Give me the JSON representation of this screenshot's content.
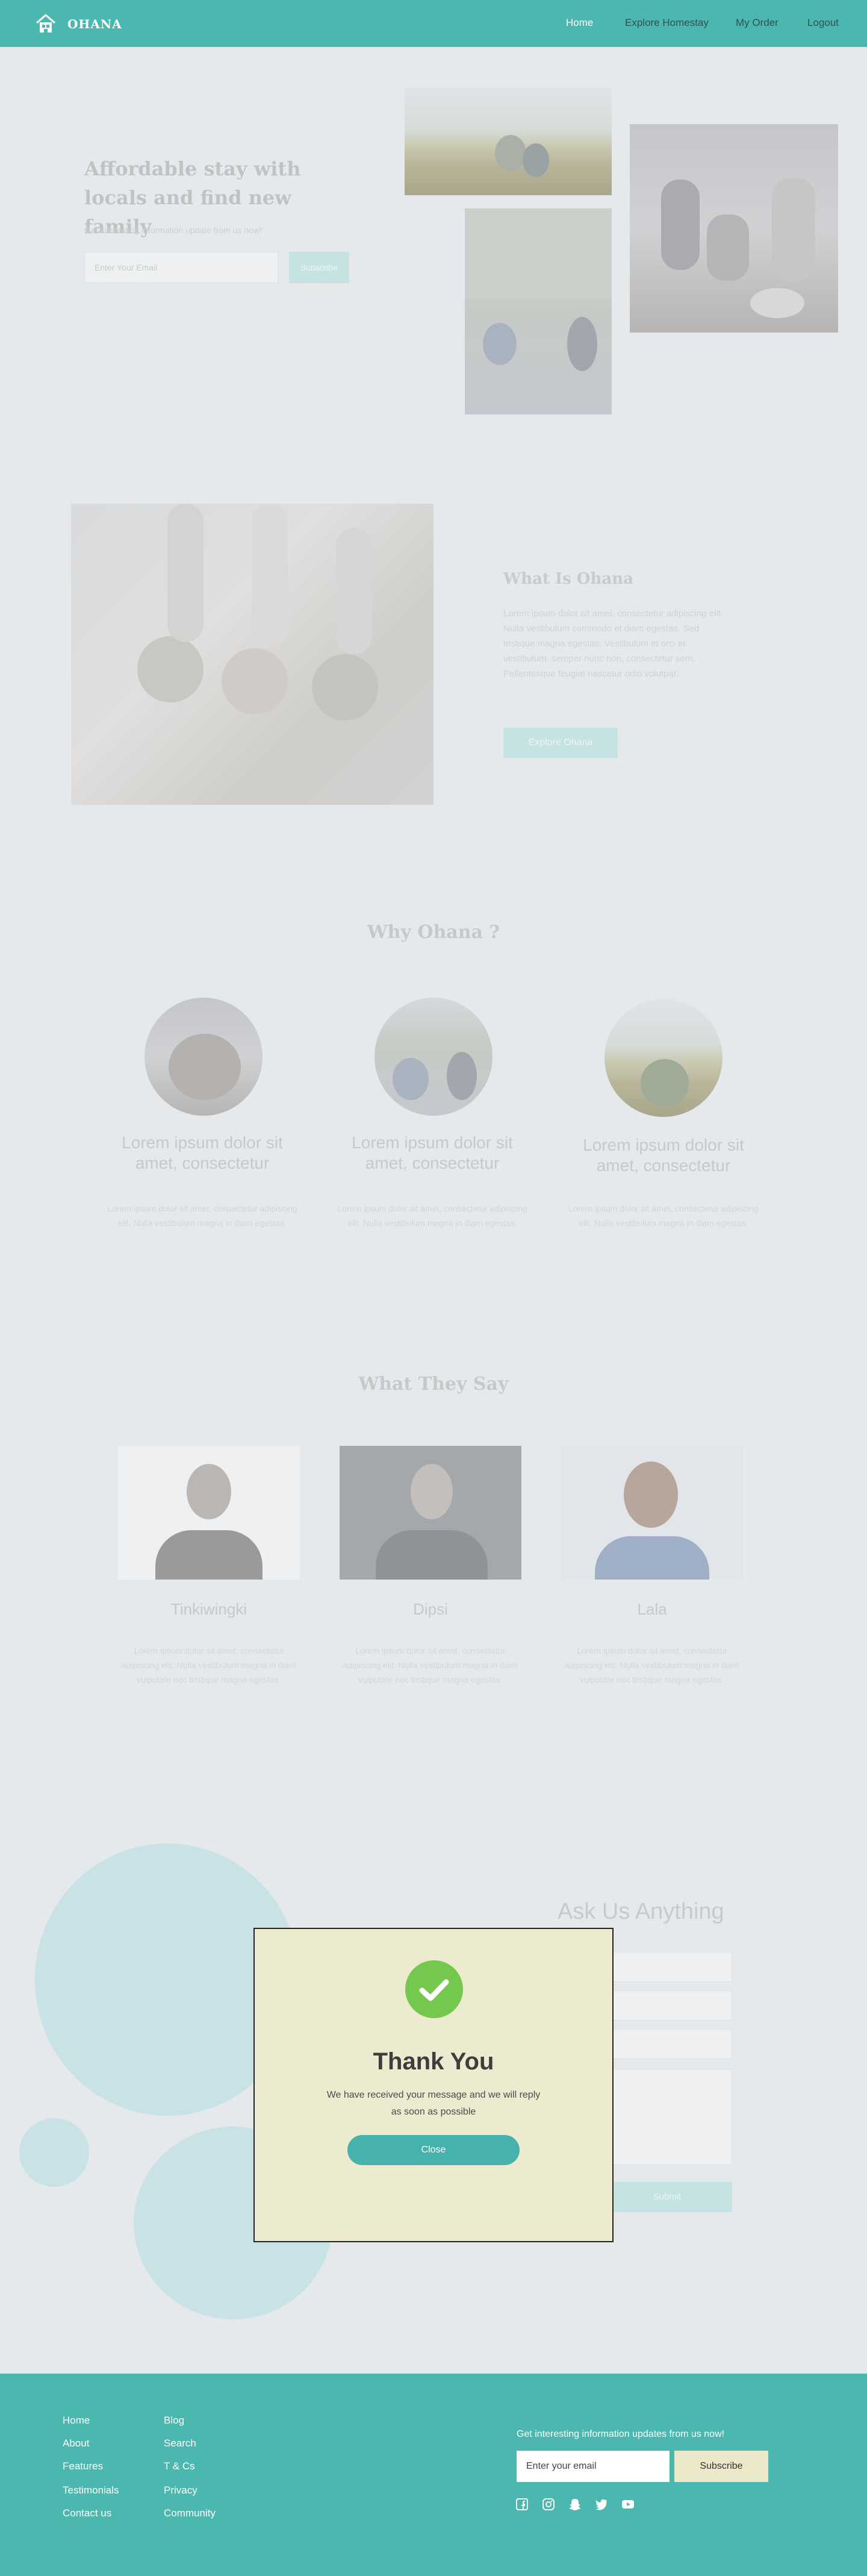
{
  "header": {
    "brand": "OHANA",
    "nav": [
      "Home",
      "Explore Homestay",
      "My Order",
      "Logout"
    ]
  },
  "hero": {
    "title": "Affordable stay with locals and find new family",
    "subtitle": "Get interesting information update from us now!",
    "email_placeholder": "Enter Your Email",
    "subscribe_label": "Subscribe"
  },
  "about": {
    "title": "What Is Ohana",
    "text": "Lorem ipsum dolor sit amet, consectetur adipiscing elit. Nulla vestibulum commodo et diam egestas. Sed tristique magna egestas. Vestibulum et orci et vestibulum, semper nunc non, consectetur sem. Pellentesque feugiat nascetur odio volutpat.",
    "button_label": "Explore Ohana"
  },
  "why": {
    "title": "Why Ohana ?",
    "cards": [
      {
        "title": "Lorem ipsum dolor sit amet, consectetur",
        "text": "Lorem ipsum dolor sit amet, consectetur adipiscing elit. Nulla vestibulum magna in diam egestas."
      },
      {
        "title": "Lorem ipsum dolor sit amet, consectetur",
        "text": "Lorem ipsum dolor sit amet, consectetur adipiscing elit. Nulla vestibulum magna in diam egestas."
      },
      {
        "title": "Lorem ipsum dolor sit amet, consectetur",
        "text": "Lorem ipsum dolor sit amet, consectetur adipiscing elit. Nulla vestibulum magna in diam egestas."
      }
    ]
  },
  "testimonials": {
    "title": "What They Say",
    "items": [
      {
        "name": "Tinkiwingki",
        "text": "Lorem ipsum dolor sit amet, consectetur adipiscing elit. Nulla vestibulum magna in diam vulputate nec tristique magna egestas."
      },
      {
        "name": "Dipsi",
        "text": "Lorem ipsum dolor sit amet, consectetur adipiscing elit. Nulla vestibulum magna in diam vulputate nec tristique magna egestas."
      },
      {
        "name": "Lala",
        "text": "Lorem ipsum dolor sit amet, consectetur adipiscing elit. Nulla vestibulum magna in diam vulputate nec tristique magna egestas."
      }
    ]
  },
  "contact": {
    "title": "Ask Us Anything",
    "submit_label": "Submit"
  },
  "modal": {
    "title": "Thank You",
    "message": "We have received your message and we will reply as soon as possible",
    "close_label": "Close"
  },
  "footer": {
    "col1": [
      "Home",
      "About",
      "Features",
      "Testimonials",
      "Contact us"
    ],
    "col2": [
      "Blog",
      "Search",
      "T & Cs",
      "Privacy",
      "Community"
    ],
    "newsletter_text": "Get interesting information updates from us now!",
    "email_placeholder": "Enter your email",
    "subscribe_label": "Subscribe",
    "social_icons": [
      "facebook-icon",
      "instagram-icon",
      "snapchat-icon",
      "twitter-icon",
      "youtube-icon"
    ]
  },
  "colors": {
    "primary": "#4bb8b0",
    "success": "#75c84e",
    "modal_bg": "#eceacf"
  }
}
